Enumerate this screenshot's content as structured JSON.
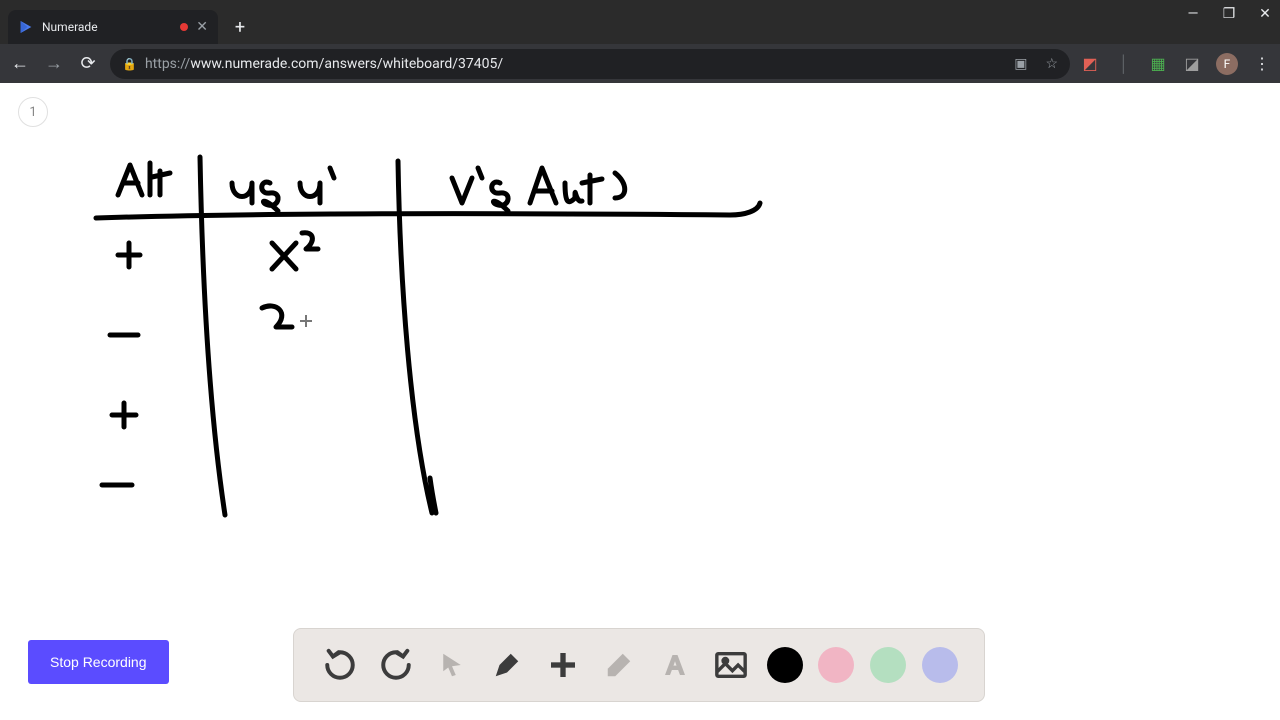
{
  "browser": {
    "tab_title": "Numerade",
    "url_proto": "https://",
    "url_rest": "www.numerade.com/answers/whiteboard/37405/",
    "avatar_letter": "F"
  },
  "page": {
    "counter": "1",
    "stop_button": "Stop Recording"
  },
  "handwriting": {
    "col1_header": "Alt",
    "col2_header": "u & u'",
    "col3_header": "v' & Ant",
    "col1_rows": [
      "+",
      "−",
      "+",
      "−"
    ],
    "col2_rows": [
      "x²",
      "2"
    ],
    "cursor_glyph": "+"
  },
  "colors": {
    "accent": "#5b4cff",
    "ink": "#000000"
  }
}
